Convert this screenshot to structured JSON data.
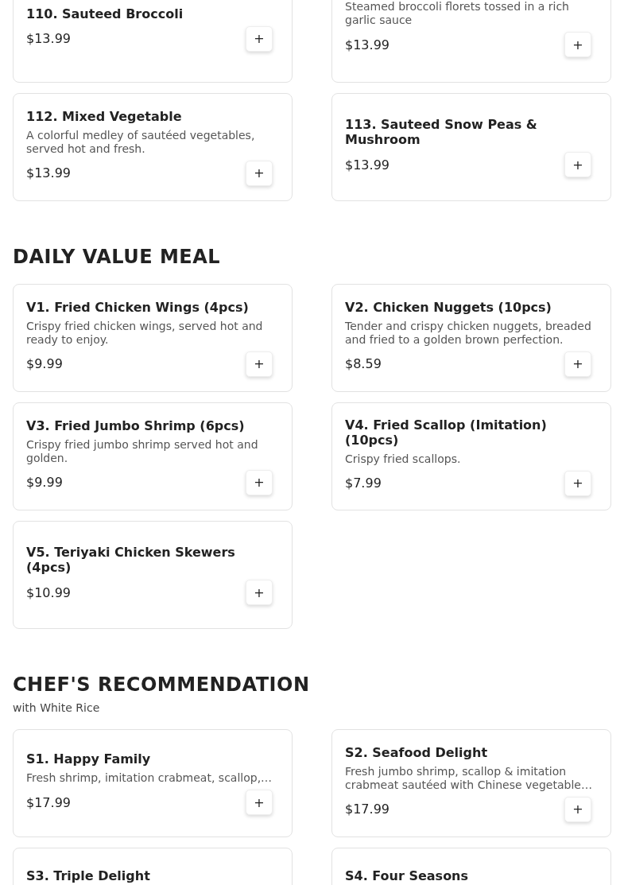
{
  "sections": [
    {
      "items": [
        {
          "title": "110. Sauteed Broccoli",
          "price": "$13.99",
          "add": "+"
        },
        {
          "description": "Steamed broccoli florets tossed in a rich garlic sauce",
          "price": "$13.99",
          "add": "+"
        },
        {
          "title": "112. Mixed Vegetable",
          "description": "A colorful medley of sautéed vegetables, served hot and fresh.",
          "price": "$13.99",
          "add": "+"
        },
        {
          "title": "113. Sauteed Snow Peas & Mushroom",
          "price": "$13.99",
          "add": "+"
        }
      ]
    },
    {
      "title": "DAILY VALUE MEAL",
      "items": [
        {
          "title": "V1. Fried Chicken Wings (4pcs)",
          "description": "Crispy fried chicken wings, served hot and ready to enjoy.",
          "price": "$9.99",
          "add": "+"
        },
        {
          "title": "V2. Chicken Nuggets (10pcs)",
          "description": "Tender and crispy chicken nuggets, breaded and fried to a golden brown perfection.",
          "price": "$8.59",
          "add": "+"
        },
        {
          "title": "V3. Fried Jumbo Shrimp (6pcs)",
          "description": "Crispy fried jumbo shrimp served hot and golden.",
          "price": "$9.99",
          "add": "+"
        },
        {
          "title": "V4. Fried Scallop (Imitation) (10pcs)",
          "description": "Crispy fried scallops.",
          "price": "$7.99",
          "add": "+"
        },
        {
          "title": "V5. Teriyaki Chicken Skewers (4pcs)",
          "price": "$10.99",
          "add": "+"
        }
      ]
    },
    {
      "title": "CHEF'S RECOMMENDATION",
      "subtitle": "with White Rice",
      "items": [
        {
          "title": "S1. Happy Family",
          "description": "Fresh shrimp, imitation crabmeat, scallop,…",
          "price": "$17.99",
          "add": "+"
        },
        {
          "title": "S2. Seafood Delight",
          "description": "Fresh jumbo shrimp, scallop & imitation crabmeat sautéed with Chinese vegetable…",
          "price": "$17.99",
          "add": "+"
        },
        {
          "title": "S3. Triple Delight"
        },
        {
          "title": "S4. Four Seasons"
        }
      ]
    }
  ]
}
